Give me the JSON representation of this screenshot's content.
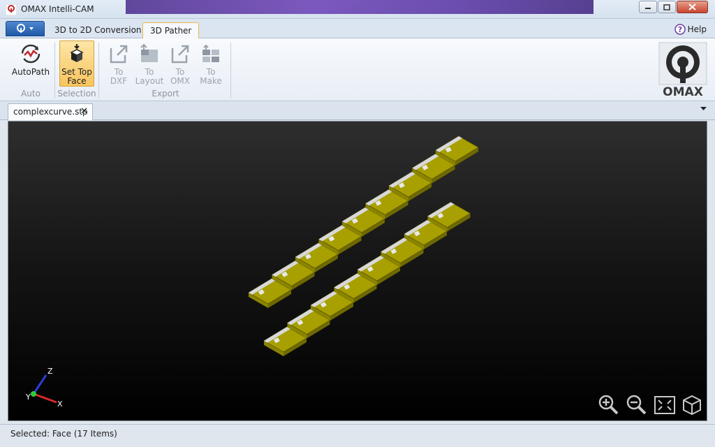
{
  "window": {
    "title": "OMAX Intelli-CAM",
    "minimize_icon": "minimize-icon",
    "maximize_icon": "maximize-icon",
    "close_icon": "close-icon"
  },
  "ribbon_tabs": [
    {
      "label": "3D to 2D Conversion",
      "active": false
    },
    {
      "label": "3D Pather",
      "active": true
    }
  ],
  "help": {
    "label": "Help",
    "icon": "help-icon"
  },
  "ribbon": {
    "auto": {
      "group_label": "Auto",
      "autopath": {
        "label": "AutoPath",
        "icon": "autopath-icon"
      }
    },
    "selection": {
      "group_label": "Selection",
      "set_top_face": {
        "label_line1": "Set Top",
        "label_line2": "Face",
        "icon": "set-top-face-icon"
      }
    },
    "export": {
      "group_label": "Export",
      "to_dxf": {
        "line1": "To",
        "line2": "DXF",
        "icon": "export-dxf-icon"
      },
      "to_layout": {
        "line1": "To",
        "line2": "Layout",
        "icon": "export-layout-icon"
      },
      "to_omx": {
        "line1": "To",
        "line2": "OMX",
        "icon": "export-omx-icon"
      },
      "to_make": {
        "line1": "To",
        "line2": "Make",
        "icon": "export-make-icon"
      }
    },
    "logo_text": "OMAX"
  },
  "document_tab": {
    "label": "complexcurve.stp",
    "close": "✕"
  },
  "viewport": {
    "axes": {
      "x": "X",
      "y": "Y",
      "z": "Z"
    },
    "controls": [
      {
        "name": "zoom-in-icon"
      },
      {
        "name": "zoom-out-icon"
      },
      {
        "name": "zoom-fit-icon"
      },
      {
        "name": "view-cube-icon"
      }
    ],
    "part_color": "#a8a000",
    "part_edge_color": "#d8d8d8"
  },
  "status": {
    "text": "Selected: Face (17 Items)"
  }
}
